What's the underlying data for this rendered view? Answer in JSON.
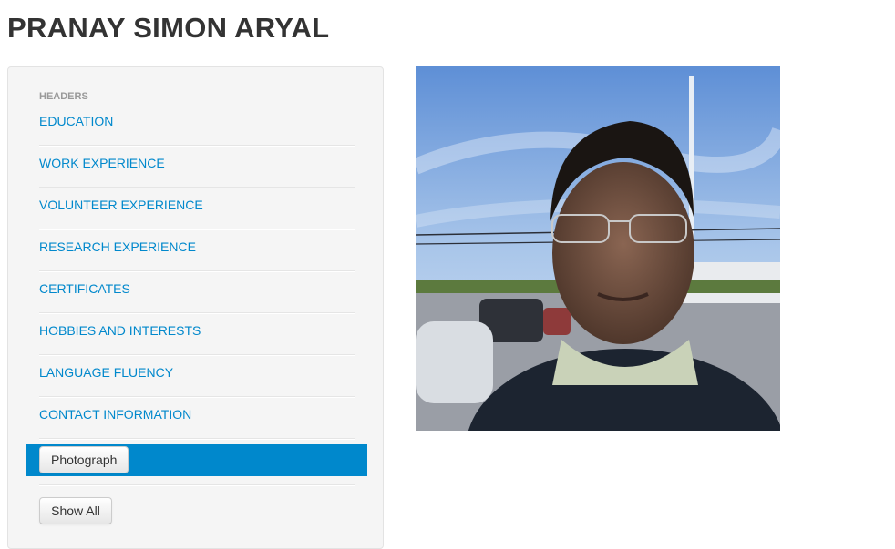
{
  "page": {
    "title": "PRANAY SIMON ARYAL"
  },
  "sidebar": {
    "header": "HEADERS",
    "items": [
      {
        "label": "EDUCATION"
      },
      {
        "label": "WORK EXPERIENCE"
      },
      {
        "label": "VOLUNTEER EXPERIENCE"
      },
      {
        "label": "RESEARCH EXPERIENCE"
      },
      {
        "label": "CERTIFICATES"
      },
      {
        "label": "HOBBIES AND INTERESTS"
      },
      {
        "label": "LANGUAGE FLUENCY"
      },
      {
        "label": "CONTACT INFORMATION"
      }
    ],
    "active_button": "Photograph",
    "show_all_button": "Show All"
  },
  "colors": {
    "link": "#0088cc",
    "active_bg": "#0088cc",
    "title": "#333333",
    "sidebar_bg": "#f5f5f5"
  }
}
